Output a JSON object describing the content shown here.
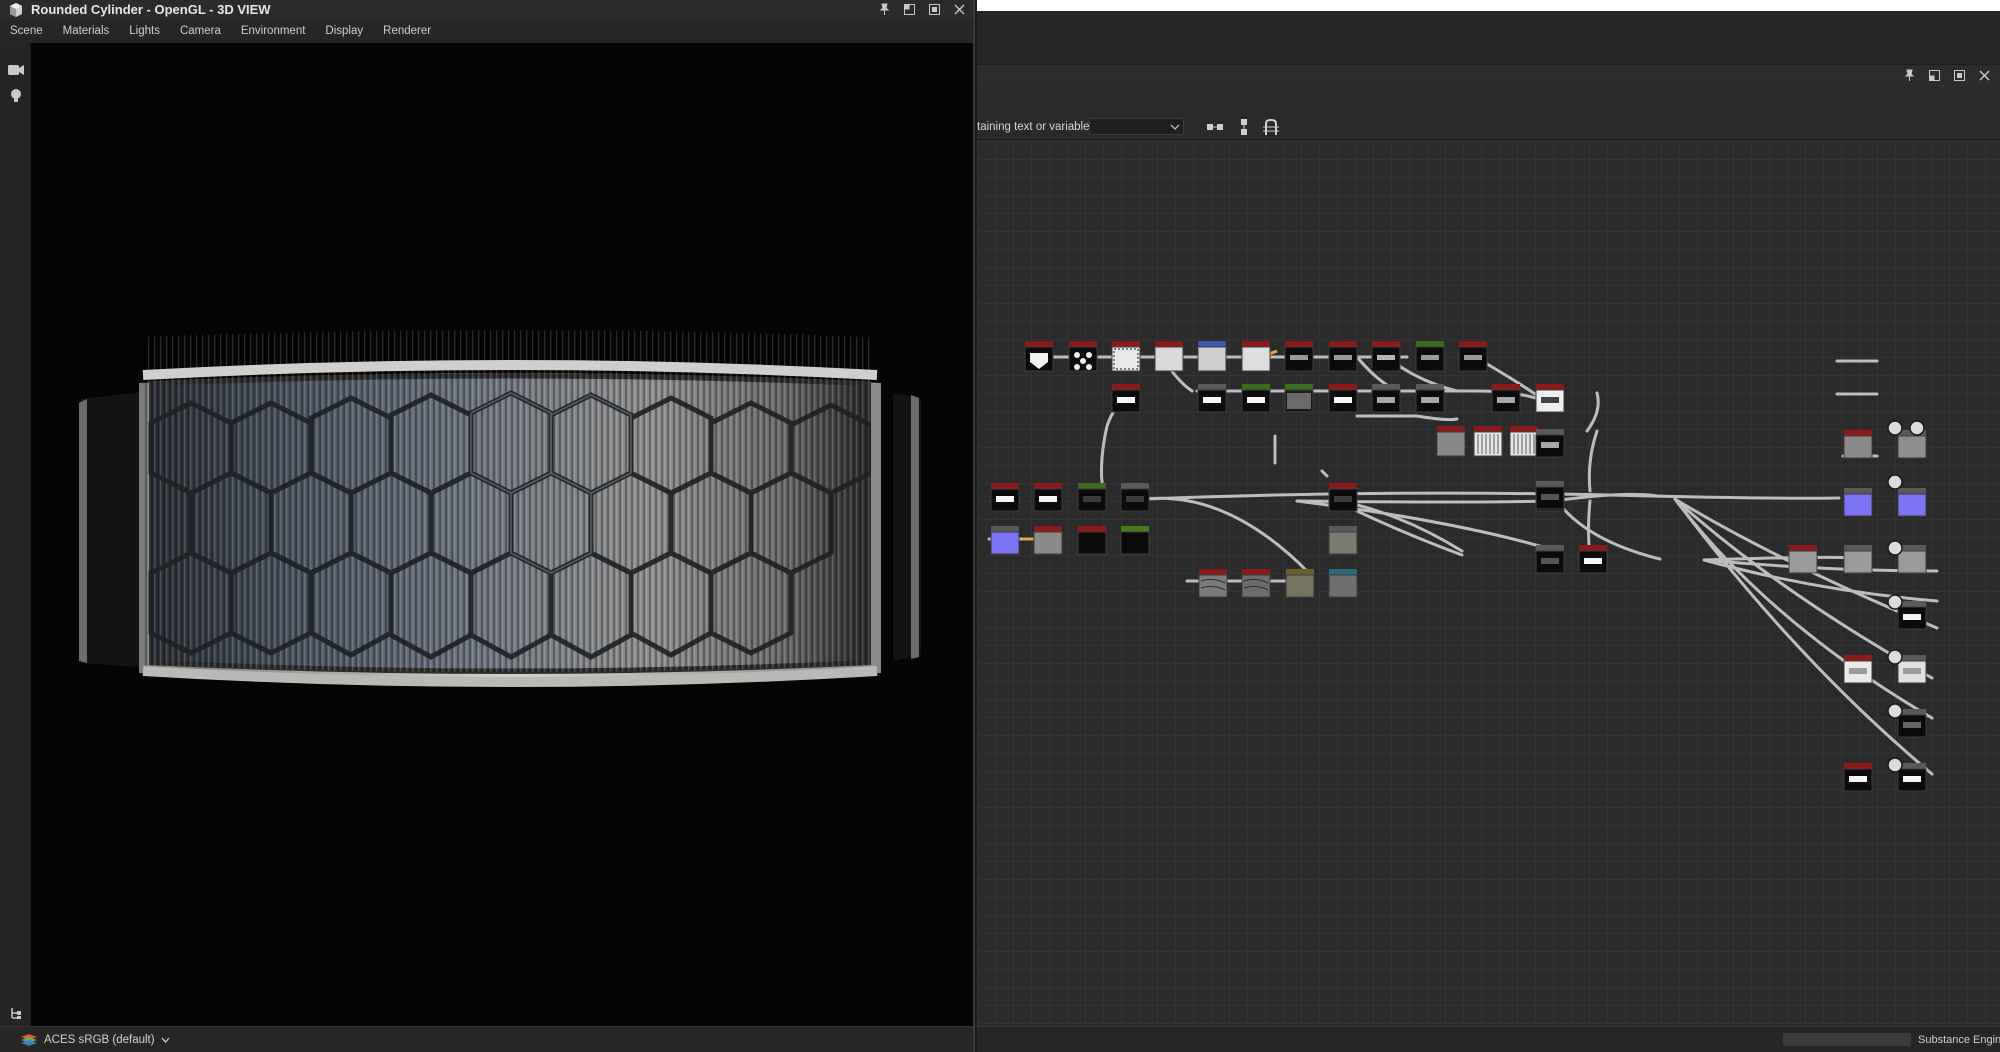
{
  "view3d": {
    "title": "Rounded Cylinder - OpenGL - 3D VIEW",
    "menu": [
      "Scene",
      "Materials",
      "Lights",
      "Camera",
      "Environment",
      "Display",
      "Renderer"
    ],
    "colorspace": "ACES sRGB (default)"
  },
  "graph": {
    "search_label": "taining text or variable",
    "search_value": "",
    "engine_label": "Substance Engin"
  },
  "colors": {
    "node_header_red": "#8b1a1a",
    "node_header_green": "#3b6b20",
    "node_normal_blue": "#7c74f2",
    "wire": "#bdbdbd",
    "wire_highlight": "#e3a63b"
  }
}
